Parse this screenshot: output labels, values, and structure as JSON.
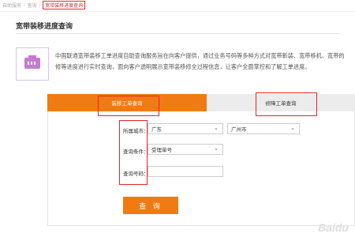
{
  "breadcrumb": {
    "items": [
      "自助服务",
      "查询",
      "宽带装移进度查询"
    ],
    "separator": "|"
  },
  "page": {
    "title": "宽带装移进度查询",
    "description": "中国联通宽带装移工单进度自助查询服务旨在向客户提供，通过业务号码等多种方式对宽带新装、宽带移机、宽带的修等进度进行实时查询，面向客户透明展示宽带装移修全过程信息，让客户全面掌控和了解工单进度。"
  },
  "tabs": [
    {
      "label": "装移工单查询",
      "active": true
    },
    {
      "label": "修障工单查询",
      "active": false
    }
  ],
  "form": {
    "city_label": "所属城市：",
    "province_value": "广东",
    "city_value": "广州市",
    "condition_label": "查询条件：",
    "condition_value": "受理单号",
    "number_label": "查询号码：",
    "number_value": "",
    "submit_label": "查 询"
  },
  "watermark": "Baidu",
  "colors": {
    "accent": "#f07b12",
    "highlight": "#e22222",
    "icon": "#c47cd0"
  }
}
